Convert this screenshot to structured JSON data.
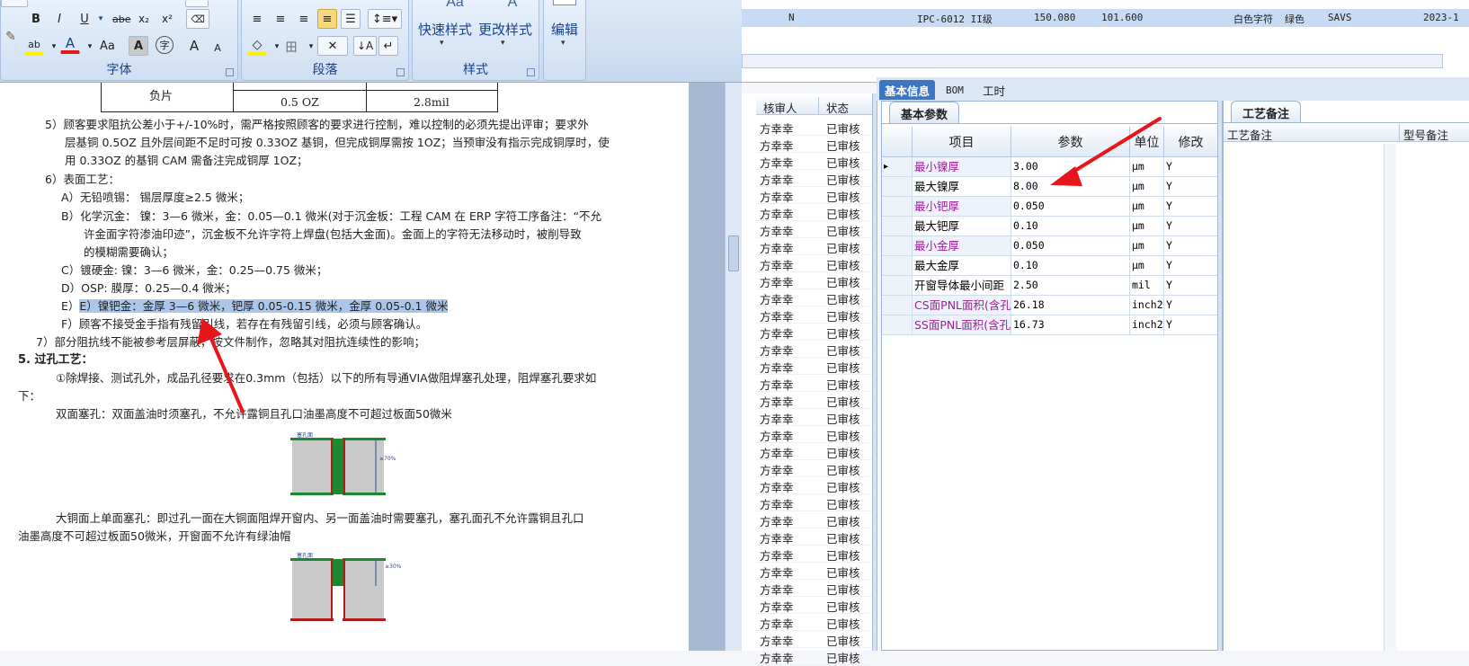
{
  "ribbon": {
    "font_buttons": [
      "B",
      "I",
      "U",
      "abe",
      "x₂",
      "x²"
    ],
    "font_row2": [
      "ab",
      "A",
      "Aa",
      "A",
      "字",
      "A",
      "A"
    ],
    "para_row2": [
      "◇",
      "田",
      "✕",
      "↓A",
      "↵"
    ],
    "group_font": "字体",
    "group_paragraph": "段落",
    "group_styles": "样式",
    "quick_styles": "快速样式",
    "change_styles": "更改样式",
    "edit": "编辑"
  },
  "doc": {
    "table": {
      "label": "负片",
      "cell1": "0.5 OZ",
      "cell2": "2.8mil"
    },
    "p5a": "5）顾客要求阻抗公差小于+/-10%时，需严格按照顾客的要求进行控制，难以控制的必须先提出评审；要求外",
    "p5b": "层基铜 0.5OZ 且外层间距不足时可按 0.33OZ 基铜，但完成铜厚需按 1OZ；当预审没有指示完成铜厚时，使",
    "p5c": "用 0.33OZ 的基铜 CAM 需备注完成铜厚 1OZ；",
    "p6": "6）表面工艺：",
    "pA": "A）无铅喷锡：  锡层厚度≥2.5 微米；",
    "pB1": "B）化学沉金：  镍：3—6 微米，金：0.05—0.1 微米(对于沉金板：工程 CAM 在 ERP 字符工序备注：“不允",
    "pB2": "许金面字符渗油印迹”，沉金板不允许字符上焊盘(包括大金面)。金面上的字符无法移动时，被削导致",
    "pB3": "的模糊需要确认；",
    "pC": "C）镀硬金:     镍：3—6 微米，金：0.25—0.75 微米；",
    "pD": "D）OSP:        膜厚：0.25—0.4 微米；",
    "pE": "E）镍钯金：金厚 3—6 微米，钯厚 0.05-0.15 微米，金厚 0.05-0.1 微米",
    "pF": "F）顾客不接受金手指有残留引线，若存在有残留引线，必须与顾客确认。",
    "p7": "7）部分阻抗线不能被参考层屏蔽，按文件制作，忽略其对阻抗连续性的影响；",
    "h5": "5.  过孔工艺：",
    "v1a": "①除焊接、测试孔外，成品孔径要求在0.3mm（包括）以下的所有导通VIA做阻焊塞孔处理，阻焊塞孔要求如",
    "v1b": "下：",
    "v2": "双面塞孔：双面盖油时须塞孔，不允许露铜且孔口油墨高度不可超过板面50微米",
    "v3a": "大铜面上单面塞孔：即过孔一面在大铜面阻焊开窗内、另一面盖油时需要塞孔，塞孔面孔不允许露铜且孔口",
    "v3b": "油墨高度不可超过板面50微米，开窗面不允许有绿油帽",
    "fig1_label": "≥70%",
    "fig2_label": "≥30%",
    "fig_head": "塞孔面"
  },
  "erp_top": {
    "n": "N",
    "grade": "IPC-6012 II级",
    "v1": "150.080",
    "v2": "101.600",
    "text_color": "白色字符",
    "mask_color": "绿色",
    "code": "SAVS",
    "date": "2023-1"
  },
  "reviewer": {
    "col_reviewer": "核审人",
    "col_status": "状态",
    "name": "方幸幸",
    "status": "已审核"
  },
  "tabs": [
    "基本信息",
    "BOM",
    "工时"
  ],
  "params": {
    "subtab": "基本参数",
    "headers": {
      "item": "项目",
      "param": "参数",
      "unit": "单位",
      "modify": "修改"
    },
    "rows": [
      {
        "item": "最小镍厚",
        "value": "3.00",
        "unit": "μm",
        "mod": "Y",
        "pink": true
      },
      {
        "item": "最大镍厚",
        "value": "8.00",
        "unit": "μm",
        "mod": "Y",
        "pink": false
      },
      {
        "item": "最小钯厚",
        "value": "0.050",
        "unit": "μm",
        "mod": "Y",
        "pink": true
      },
      {
        "item": "最大钯厚",
        "value": "0.10",
        "unit": "μm",
        "mod": "Y",
        "pink": false
      },
      {
        "item": "最小金厚",
        "value": "0.050",
        "unit": "μm",
        "mod": "Y",
        "pink": true
      },
      {
        "item": "最大金厚",
        "value": "0.10",
        "unit": "μm",
        "mod": "Y",
        "pink": false
      },
      {
        "item": "开窗导体最小间距",
        "value": "2.50",
        "unit": "mil",
        "mod": "Y",
        "pink": false
      },
      {
        "item": "CS面PNL面积(含孔)",
        "value": "26.18",
        "unit": "inch2",
        "mod": "Y",
        "pink": true
      },
      {
        "item": "SS面PNL面积(含孔)",
        "value": "16.73",
        "unit": "inch2",
        "mod": "Y",
        "pink": true
      }
    ]
  },
  "notes": {
    "subtab": "工艺备注",
    "col1": "工艺备注",
    "col2": "型号备注"
  },
  "colors": {
    "annotation_arrow": "#e8161b",
    "active_tab": "#3f76c3",
    "pink_text": "#a01b9a"
  }
}
